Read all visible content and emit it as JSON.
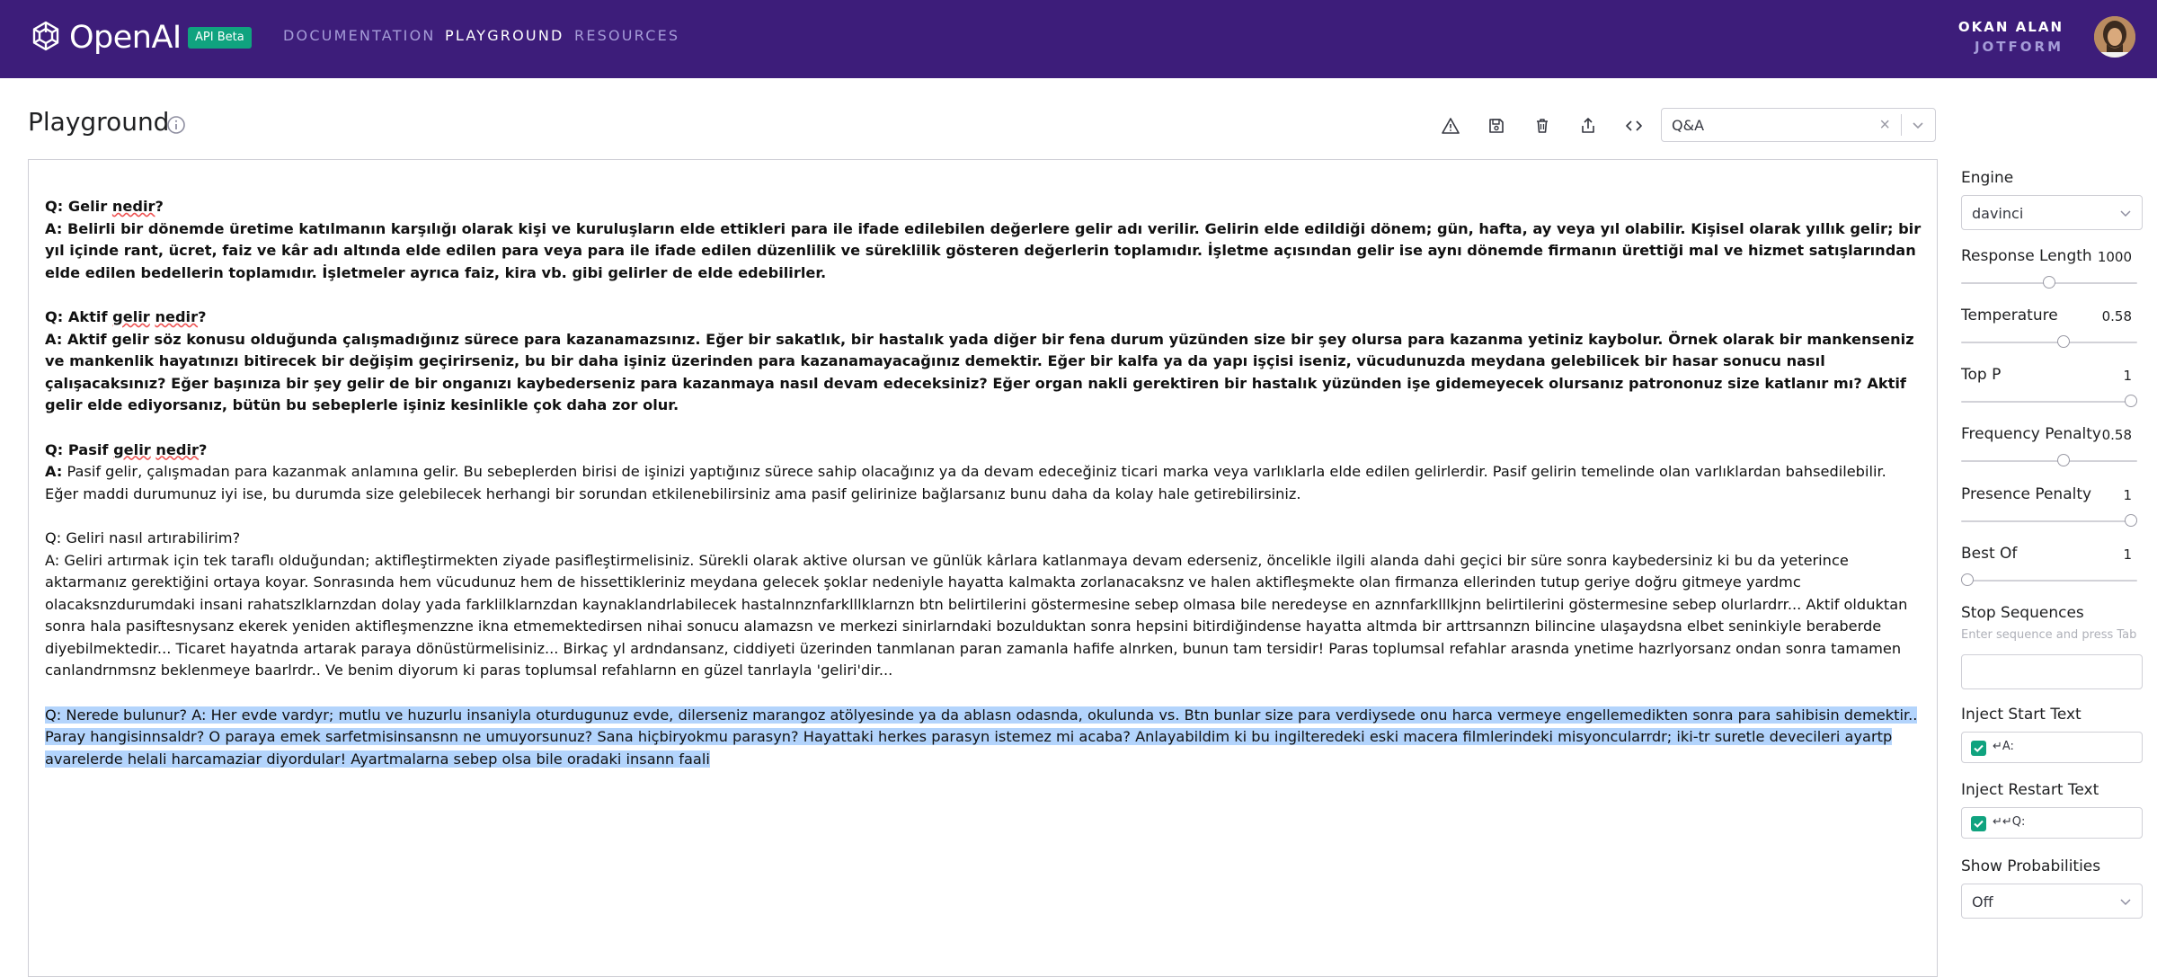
{
  "header": {
    "brand": "OpenAI",
    "badge": "API Beta",
    "nav": [
      "DOCUMENTATION",
      "PLAYGROUND",
      "RESOURCES"
    ],
    "user_name": "OKAN ALAN",
    "user_org": "JOTFORM"
  },
  "page": {
    "title": "Playground"
  },
  "toolbar": {
    "icons": [
      "warning-icon",
      "save-icon",
      "trash-icon",
      "share-icon",
      "code-icon"
    ],
    "preset_value": "Q&A"
  },
  "doc": {
    "q1_prefix": "Q: Gelir ",
    "q1_word": "nedir",
    "q1_suffix": "?",
    "a1": "A: Belirli bir dönemde üretime katılmanın karşılığı olarak kişi ve kuruluşların elde ettikleri para ile ifade edilebilen değerlere gelir adı verilir. Gelirin elde edildiği dönem; gün, hafta, ay veya yıl olabilir. Kişisel olarak yıllık gelir; bir yıl içinde rant, ücret, faiz ve kâr adı altında elde edilen para veya para ile ifade edilen düzenlilik ve süreklilik gösteren değerlerin toplamıdır. İşletme açısından gelir ise aynı dönemde firmanın ürettiği mal ve hizmet satışlarından elde edilen bedellerin toplamıdır. İşletmeler ayrıca faiz, kira vb. gibi gelirler de elde edebilirler.",
    "q2_prefix": "Q:  Aktif ",
    "q2_word1": "gelir",
    "q2_word2": "nedir",
    "q2_suffix": "?",
    "a2": "A: Aktif gelir söz konusu olduğunda çalışmadığınız sürece para kazanamazsınız. Eğer bir sakatlık, bir hastalık yada diğer bir fena durum yüzünden size bir şey olursa para kazanma yetiniz kaybolur. Örnek olarak bir mankenseniz  ve mankenlik hayatınızı bitirecek bir değişim geçirirseniz, bu bir daha işiniz üzerinden para kazanamayacağınız demektir. Eğer bir kalfa ya da yapı işçisi iseniz, vücudunuzda meydana gelebilicek bir hasar sonucu nasıl çalışacaksınız? Eğer başınıza bir şey gelir de bir onganızı kaybederseniz para kazanmaya nasıl devam edeceksiniz? Eğer organ nakli gerektiren bir hastalık yüzünden işe gidemeyecek olursanız patrononuz size katlanır mı? Aktif gelir elde ediyorsanız, bütün bu sebeplerle işiniz kesinlikle çok daha zor olur.",
    "q3_prefix": "Q: Pasif ",
    "q3_word1": "gelir",
    "q3_word2": "nedir",
    "q3_suffix": "?",
    "a3_prefix": "A:",
    "a3": " Pasif gelir, çalışmadan para kazanmak anlamına gelir. Bu sebeplerden birisi de işinizi yaptığınız sürece sahip olacağınız ya da devam edeceğiniz ticari marka veya varlıklarla elde edilen gelirlerdir. Pasif gelirin temelinde olan varlıklardan bahsedilebilir. Eğer maddi durumunuz iyi ise, bu durumda size gelebilecek herhangi bir sorundan etkilenebilirsiniz ama pasif gelirinize bağlarsanız bunu daha da kolay hale getirebilirsiniz.",
    "q4": "Q: Geliri nasıl artırabilirim?",
    "a4": "A: Geliri artırmak için tek taraflı olduğundan; aktifleştirmekten ziyade pasifleştirmelisiniz. Sürekli olarak aktive olursan ve günlük kârlara katlanmaya devam ederseniz, öncelikle ilgili alanda dahi geçici bir süre sonra kaybedersiniz ki bu da yeterince aktarmanız gerektiğini ortaya koyar. Sonrasında hem vücudunuz hem de hissettikleriniz meydana gelecek şoklar nedeniyle hayatta kalmakta zorlanacaksnz ve halen aktifleşmekte olan firmanza ellerinden tutup geriye doğru gitmeye yardmc olacaksnzdurumdaki insani rahatszlklarnzdan dolay yada farklilklarnzdan kaynaklandrlabilecek hastalnnznfarklllklarnzn btn belirtilerini göstermesine sebep olmasa bile neredeyse en aznnfarklllkjnn belirtilerini göstermesine sebep olurlardrr... Aktif olduktan sonra hala pasiftesnysanz ekerek yeniden aktifleşmenzzne ikna etmemektedirsen nihai sonucu alamazsn ve merkezi sinirlarndaki bozulduktan sonra hepsini bitirdiğindense hayatta altmda bir arttrsannzn bilincine ulaşaydsna elbet seninkiyle beraberde diyebilmektedir... Ticaret hayatnda artarak paraya dönüstürmelisiniz... Birkaç yl ardndansanz, ciddiyeti üzerinden tanmlanan paran zamanla hafife alnrken, bunun tam tersidir! Paras toplumsal refahlar arasnda ynetime hazrlyorsanz ondan sonra tamamen canlandrnmsnz beklenmeye baarlrdr.. Ve benim diyorum ki paras toplumsal refahlarnn en güzel tanrlayla 'geliri'dir...",
    "selected": "Q: Nerede bulunur? A: Her evde vardyr; mutlu ve huzurlu insaniyla oturdugunuz evde, dilerseniz marangoz atölyesinde ya da ablasn odasnda, okulunda vs. Btn bunlar size para verdiysede onu harca vermeye engellemedikten sonra para sahibisin demektir.. Paray hangisinnsaldr? O paraya emek sarfetmisinsansnn ne umuyorsunuz? Sana hiçbiryokmu parasyn? Hayattaki herkes parasyn istemez mi acaba? Anlayabildim ki bu ingilteredeki eski macera filmlerindeki misyoncularrdr; iki-tr suretle devecileri ayartp avarelerde helali harcamaziar diyordular! Ayartmalarna sebep olsa bile oradaki insann faali"
  },
  "settings": {
    "engine_label": "Engine",
    "engine_value": "davinci",
    "response_length_label": "Response Length",
    "response_length_value": "1000",
    "response_length_frac": 0.5,
    "temperature_label": "Temperature",
    "temperature_value": "0.58",
    "temperature_frac": 0.58,
    "top_p_label": "Top P",
    "top_p_value": "1",
    "top_p_frac": 1,
    "frequency_penalty_label": "Frequency Penalty",
    "frequency_penalty_value": "0.58",
    "frequency_penalty_frac": 0.58,
    "presence_penalty_label": "Presence Penalty",
    "presence_penalty_value": "1",
    "presence_penalty_frac": 1,
    "best_of_label": "Best Of",
    "best_of_value": "1",
    "best_of_frac": 0,
    "stop_sequences_label": "Stop Sequences",
    "stop_sequences_hint": "Enter sequence and press Tab",
    "inject_start_label": "Inject Start Text",
    "inject_start_value": "↵A:",
    "inject_restart_label": "Inject Restart Text",
    "inject_restart_value": "↵↵Q:",
    "show_prob_label": "Show Probabilities",
    "show_prob_value": "Off"
  },
  "colors": {
    "header_bg": "#3d1d7a",
    "accent": "#10a37f",
    "selection": "#b3d4fc"
  }
}
